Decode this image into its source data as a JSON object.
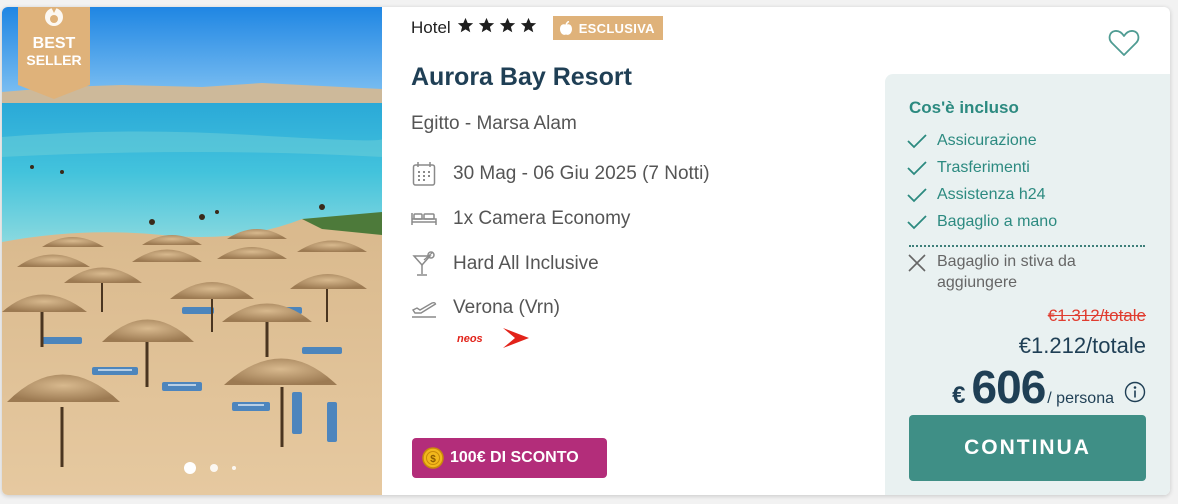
{
  "photo": {
    "badge_line1": "BEST",
    "badge_line2": "SELLER",
    "carousel": {
      "total": 3,
      "active": 1
    }
  },
  "hotel": {
    "category_label": "Hotel",
    "stars": 4,
    "exclusive_badge": "ESCLUSIVA",
    "name": "Aurora Bay Resort",
    "location": "Egitto - Marsa Alam"
  },
  "details": {
    "dates": "30 Mag - 06 Giu 2025 (7 Notti)",
    "room": "1x Camera Economy",
    "board": "Hard All Inclusive",
    "departure": "Verona (Vrn)",
    "airline_logo": "neos"
  },
  "discount": {
    "label": "100€ DI SCONTO"
  },
  "included": {
    "title": "Cos'è incluso",
    "items": [
      "Assicurazione",
      "Trasferimenti",
      "Assistenza h24",
      "Bagaglio a mano"
    ],
    "excluded": [
      "Bagaglio in stiva da aggiungere"
    ]
  },
  "price": {
    "old_total": "€1.312/totale",
    "total": "€1.212/totale",
    "currency": "€",
    "per_person_amount": "606",
    "per_person_unit": "/ persona"
  },
  "cta": {
    "label": "CONTINUA"
  },
  "colors": {
    "teal": "#2c8a80",
    "button": "#3f8f86",
    "navy": "#1f3f55",
    "discount": "#b32d7a",
    "exclusive": "#dfb27a",
    "old_price": "#e03c2f"
  }
}
